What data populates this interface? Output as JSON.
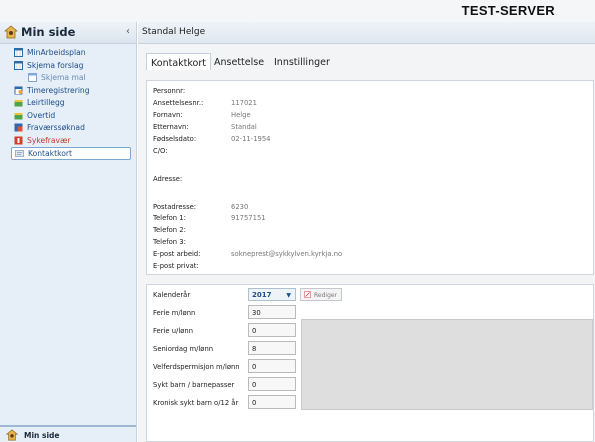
{
  "header": {
    "server": "TEST-SERVER"
  },
  "sidebar": {
    "title": "Min side",
    "collapse_symbol": "‹",
    "items": [
      {
        "label": "MinArbeidsplan",
        "icon": "calendar-grid-icon",
        "level": 0
      },
      {
        "label": "Skjema forslag",
        "icon": "calendar-grid-icon",
        "level": 0
      },
      {
        "label": "Skjema mal",
        "icon": "calendar-grid-icon",
        "level": 1
      },
      {
        "label": "Timeregistrering",
        "icon": "clock-table-icon",
        "level": 0
      },
      {
        "label": "Leirtillegg",
        "icon": "folder-green-icon",
        "level": 0
      },
      {
        "label": "Overtid",
        "icon": "folder-green-icon",
        "level": 0
      },
      {
        "label": "Fraværssøknad",
        "icon": "absence-icon",
        "level": 0
      },
      {
        "label": "Sykefravær",
        "icon": "sick-icon",
        "level": 0,
        "red": true
      },
      {
        "label": "Kontaktkort",
        "icon": "contact-card-icon",
        "level": 0,
        "active": true
      }
    ],
    "footer": "Min side"
  },
  "main": {
    "title": "Standal Helge",
    "tabs": [
      {
        "label": "Kontaktkort",
        "active": true
      },
      {
        "label": "Ansettelse",
        "active": false
      },
      {
        "label": "Innstillinger",
        "active": false
      }
    ],
    "info": {
      "personnr": {
        "label": "Personnr:",
        "value": ""
      },
      "ansattnr": {
        "label": "Ansettelsesnr.:",
        "value": "117021"
      },
      "fornavn": {
        "label": "Fornavn:",
        "value": "Helge"
      },
      "etternavn": {
        "label": "Etternavn:",
        "value": "Standal"
      },
      "fodselsdato": {
        "label": "Fødselsdato:",
        "value": "02-11-1954"
      },
      "co": {
        "label": "C/O:",
        "value": ""
      },
      "adresse": {
        "label": "Adresse:",
        "value": ""
      },
      "postadresse": {
        "label": "Postadresse:",
        "value": "6230"
      },
      "tlf1": {
        "label": "Telefon 1:",
        "value": "91757151"
      },
      "tlf2": {
        "label": "Telefon 2:",
        "value": ""
      },
      "tlf3": {
        "label": "Telefon 3:",
        "value": ""
      },
      "epost_arbeid": {
        "label": "E-post arbeid:",
        "value": "sokneprest@sykkylven.kyrkja.no"
      },
      "epost_privat": {
        "label": "E-post privat:",
        "value": ""
      }
    },
    "stats": {
      "kalenderaar_label": "Kalenderår",
      "year": "2017",
      "edit_label": "Rediger",
      "rows": [
        {
          "label": "Ferie m/lønn",
          "value": "30"
        },
        {
          "label": "Ferie u/lønn",
          "value": "0"
        },
        {
          "label": "Seniordag m/lønn",
          "value": "8"
        },
        {
          "label": "Velferdspermisjon m/lønn",
          "value": "0"
        },
        {
          "label": "Sykt barn / barnepasser",
          "value": "0"
        },
        {
          "label": "Kronisk sykt barn o/12 år",
          "value": "0"
        }
      ]
    }
  }
}
